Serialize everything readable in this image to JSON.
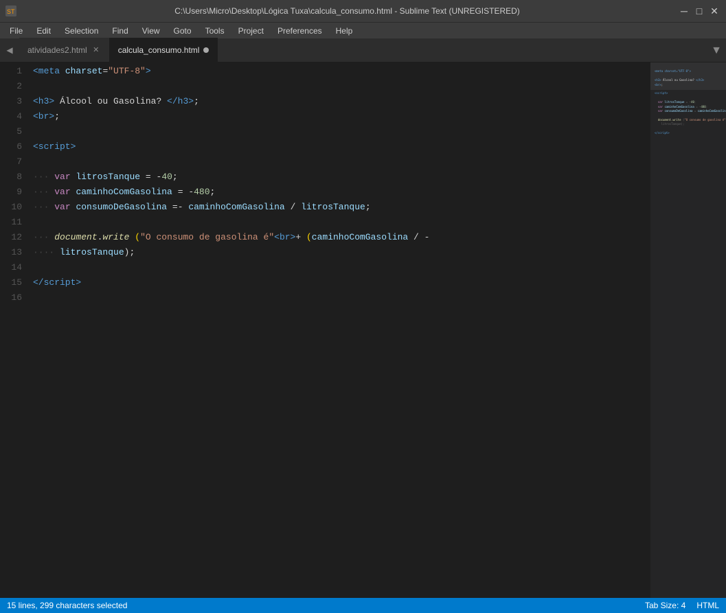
{
  "titlebar": {
    "icon": "ST",
    "title": "C:\\Users\\Micro\\Desktop\\Lógica Tuxa\\calcula_consumo.html - Sublime Text (UNREGISTERED)",
    "minimize": "─",
    "maximize": "□",
    "close": "✕"
  },
  "menubar": {
    "items": [
      "File",
      "Edit",
      "Selection",
      "Find",
      "View",
      "Goto",
      "Tools",
      "Project",
      "Preferences",
      "Help"
    ]
  },
  "tabs": [
    {
      "label": "atividades2.html",
      "active": false,
      "modified": false
    },
    {
      "label": "calcula_consumo.html",
      "active": true,
      "modified": true
    }
  ],
  "statusbar": {
    "left": "15 lines, 299 characters selected",
    "tabsize": "Tab Size: 4",
    "language": "HTML"
  },
  "lines": [
    1,
    2,
    3,
    4,
    5,
    6,
    7,
    8,
    9,
    10,
    11,
    12,
    13,
    14,
    15,
    16
  ]
}
